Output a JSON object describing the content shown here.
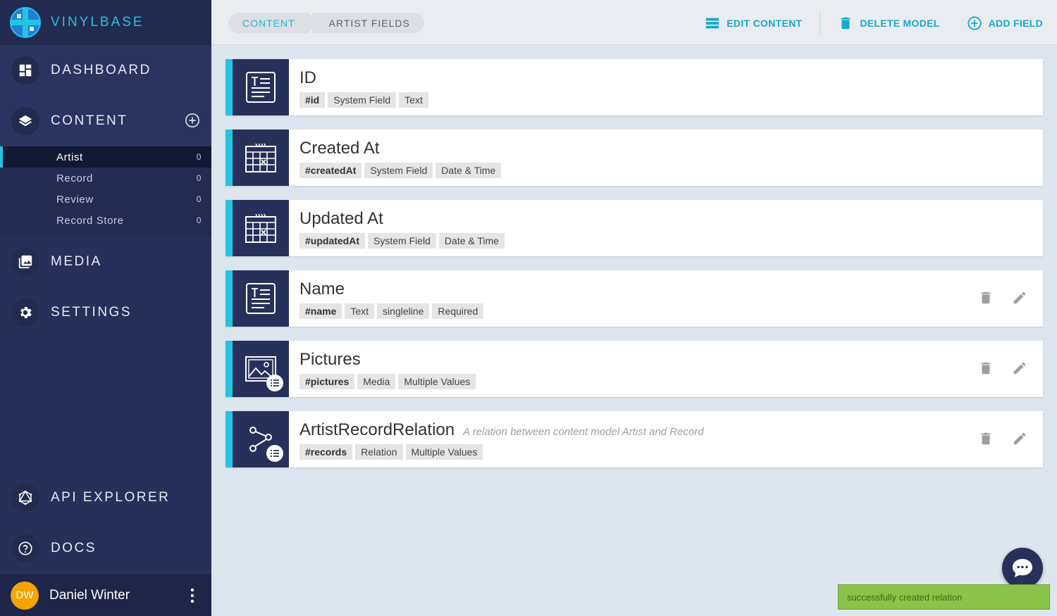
{
  "brand": {
    "name": "VINYLBASE"
  },
  "nav": {
    "dashboard": "DASHBOARD",
    "content": "CONTENT",
    "media": "MEDIA",
    "settings": "SETTINGS",
    "api_explorer": "API EXPLORER",
    "docs": "DOCS"
  },
  "content_items": [
    {
      "label": "Artist",
      "count": "0",
      "active": true
    },
    {
      "label": "Record",
      "count": "0"
    },
    {
      "label": "Review",
      "count": "0"
    },
    {
      "label": "Record Store",
      "count": "0"
    }
  ],
  "user": {
    "initials": "DW",
    "name": "Daniel Winter"
  },
  "breadcrumb": [
    "CONTENT",
    "ARTIST FIELDS"
  ],
  "actions": {
    "edit": "EDIT CONTENT",
    "delete": "DELETE MODEL",
    "add": "ADD FIELD"
  },
  "fields": [
    {
      "title": "ID",
      "desc": "",
      "tags": [
        "#id",
        "System Field",
        "Text"
      ],
      "icon": "text-field-icon"
    },
    {
      "title": "Created At",
      "desc": "",
      "tags": [
        "#createdAt",
        "System Field",
        "Date & Time"
      ],
      "icon": "calendar-icon"
    },
    {
      "title": "Updated At",
      "desc": "",
      "tags": [
        "#updatedAt",
        "System Field",
        "Date & Time"
      ],
      "icon": "calendar-icon"
    },
    {
      "title": "Name",
      "desc": "",
      "tags": [
        "#name",
        "Text",
        "singleline",
        "Required"
      ],
      "icon": "text-field-icon"
    },
    {
      "title": "Pictures",
      "desc": "",
      "tags": [
        "#pictures",
        "Media",
        "Multiple Values"
      ],
      "icon": "image-icon"
    },
    {
      "title": "ArtistRecordRelation",
      "desc": "A relation between content model Artist and Record",
      "tags": [
        "#records",
        "Relation",
        "Multiple Values"
      ],
      "icon": "relation-icon"
    }
  ],
  "toast": "successfully created relation",
  "colors": {
    "accent": "#24c3e2",
    "sidebar": "#27305a",
    "action": "#14a9d0",
    "toast": "#8bc34a"
  }
}
